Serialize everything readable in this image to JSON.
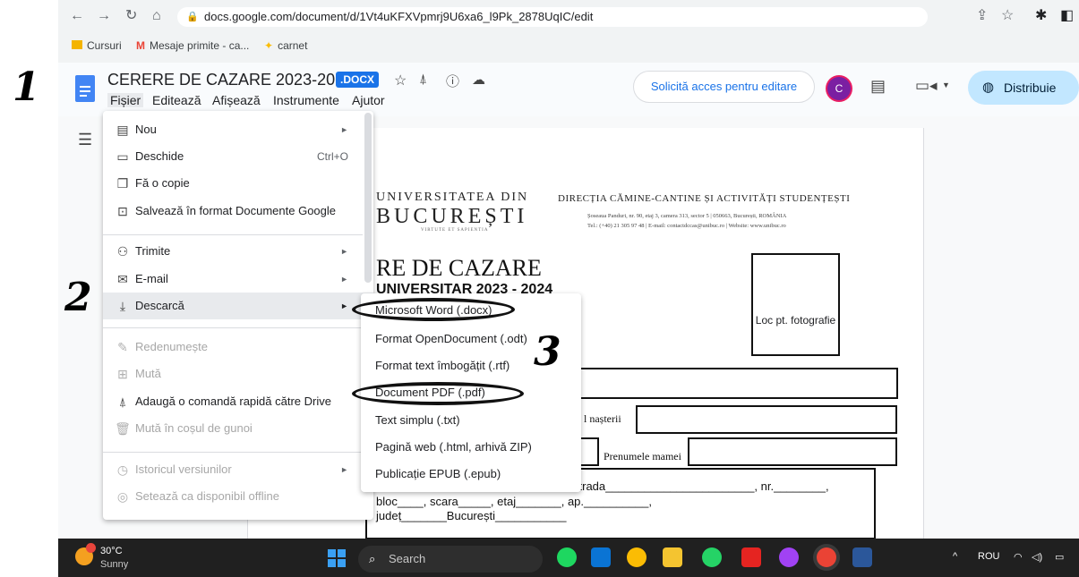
{
  "browser": {
    "url": "docs.google.com/document/d/1Vt4uKFXVpmrj9U6xa6_l9Pk_2878UqIC/edit",
    "bookmarks": [
      "Cursuri",
      "Mesaje primite - ca...",
      "carnet"
    ]
  },
  "doc": {
    "title": "CERERE DE CAZARE 2023-2024",
    "badge": ".DOCX",
    "menu": [
      "Fișier",
      "Editează",
      "Afișează",
      "Instrumente",
      "Ajutor"
    ],
    "request_access": "Solicită acces pentru editare",
    "avatar_letter": "C",
    "share": "Distribuie"
  },
  "file_menu": {
    "items": [
      {
        "icon": "file-icon",
        "label": "Nou",
        "shortcut": "",
        "arrow": true,
        "disabled": false
      },
      {
        "icon": "folder-icon",
        "label": "Deschide",
        "shortcut": "Ctrl+O",
        "arrow": false,
        "disabled": false
      },
      {
        "icon": "copy-icon",
        "label": "Fă o copie",
        "shortcut": "",
        "arrow": false,
        "disabled": false
      },
      {
        "icon": "save-icon",
        "label": "Salvează în format Documente Google",
        "shortcut": "",
        "arrow": false,
        "disabled": false
      },
      {
        "icon": "share-person-icon",
        "label": "Trimite",
        "shortcut": "",
        "arrow": true,
        "disabled": false
      },
      {
        "icon": "mail-icon",
        "label": "E-mail",
        "shortcut": "",
        "arrow": true,
        "disabled": false
      },
      {
        "icon": "download-icon",
        "label": "Descarcă",
        "shortcut": "",
        "arrow": true,
        "disabled": false
      },
      {
        "icon": "rename-icon",
        "label": "Redenumește",
        "shortcut": "",
        "arrow": false,
        "disabled": true
      },
      {
        "icon": "move-icon",
        "label": "Mută",
        "shortcut": "",
        "arrow": false,
        "disabled": true
      },
      {
        "icon": "drive-shortcut-icon",
        "label": "Adaugă o comandă rapidă către Drive",
        "shortcut": "",
        "arrow": false,
        "disabled": false
      },
      {
        "icon": "trash-icon",
        "label": "Mută în coșul de gunoi",
        "shortcut": "",
        "arrow": false,
        "disabled": true
      },
      {
        "icon": "history-icon",
        "label": "Istoricul versiunilor",
        "shortcut": "",
        "arrow": true,
        "disabled": true
      },
      {
        "icon": "offline-icon",
        "label": "Setează ca disponibil offline",
        "shortcut": "",
        "arrow": false,
        "disabled": true
      }
    ]
  },
  "download_menu": {
    "items": [
      "Microsoft Word (.docx)",
      "Format OpenDocument (.odt)",
      "Format text îmbogățit (.rtf)",
      "Document PDF (.pdf)",
      "Text simplu (.txt)",
      "Pagină web (.html, arhivă ZIP)",
      "Publicație EPUB (.epub)"
    ]
  },
  "document_page": {
    "uni_line1": "UNIVERSITATEA DIN",
    "uni_line2": "BUCUREȘTI",
    "uni_motto": "VIRTUTE ET SAPIENTIA",
    "directorate": "DIRECȚIA CĂMINE-CANTINE ȘI ACTIVITĂȚI STUDENȚEȘTI",
    "address": "Șoseaua Panduri, nr. 90, etaj 3, camera 313, sector 5 | 050663, București, ROMÂNIA",
    "contact": "Tel.: (+40) 21 305 97 48 | E-mail: contactdccas@unibuc.ro | Website: www.unibuc.ro",
    "heading": "RE DE CAZARE",
    "subheading": "UNIVERSITAR 2023 - 2024",
    "photo_label": "Loc pt. fotografie",
    "birth_label": "l nașterii",
    "mother_label": "Prenumele mamei",
    "addr_line1": "strada_______________________, nr.________,",
    "addr_line2": "bloc____, scara_____, etaj_______, ap.__________,",
    "addr_line3": "județ_______București___________"
  },
  "annotations": [
    "1",
    "2",
    "3"
  ],
  "taskbar": {
    "temp": "30°C",
    "weather": "Sunny",
    "search": "Search",
    "lang": "ROU"
  }
}
